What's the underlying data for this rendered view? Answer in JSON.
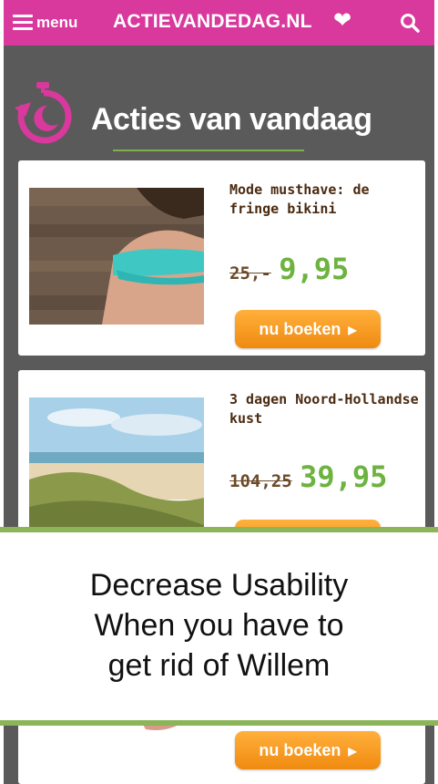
{
  "header": {
    "menu_label": "menu",
    "site_title": "ACTIEVANDEDAG.NL",
    "brand_color": "#d9389c"
  },
  "section": {
    "title": "Acties van vandaag"
  },
  "deals": [
    {
      "title": "Mode musthave: de fringe bikini",
      "old_price": "25,-",
      "new_price": "9,95",
      "button_label": "nu boeken"
    },
    {
      "title": "3 dagen Noord-Hollandse kust",
      "old_price": "104,25",
      "new_price": "39,95",
      "button_label": "nu boeken"
    },
    {
      "button_label": "nu boeken"
    }
  ],
  "overlay": {
    "lines": [
      "Decrease Usability",
      "When you have to",
      "get rid of Willem"
    ]
  },
  "colors": {
    "price_green": "#6db33f",
    "button_orange": "#f08a10",
    "divider_green": "#8bb558"
  }
}
